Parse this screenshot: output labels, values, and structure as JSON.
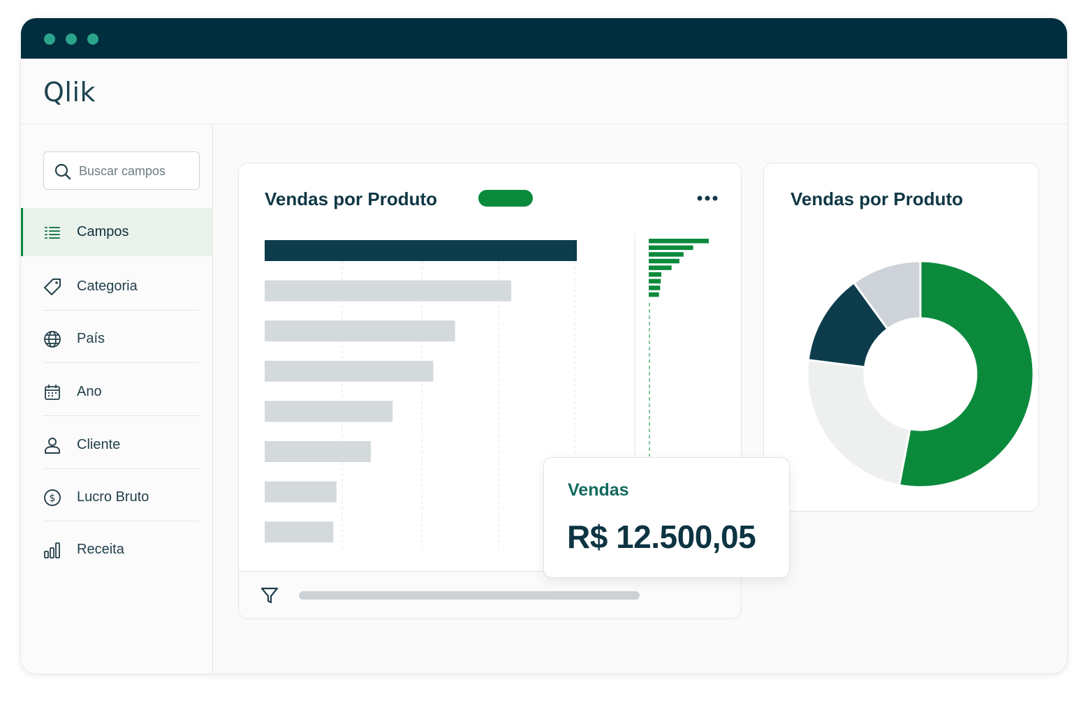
{
  "window": {
    "colors": {
      "titlebar": "#002e3f",
      "accent": "#0b8a3c",
      "dark": "#0d3c4c"
    }
  },
  "header": {
    "logo_text": "Qlik"
  },
  "sidebar": {
    "search": {
      "placeholder": "Buscar campos",
      "icon": "search-icon"
    },
    "items": [
      {
        "label": "Campos",
        "icon": "list-icon",
        "active": true
      },
      {
        "label": "Categoria",
        "icon": "tag-icon"
      },
      {
        "label": "País",
        "icon": "globe-icon"
      },
      {
        "label": "Ano",
        "icon": "calendar-icon"
      },
      {
        "label": "Cliente",
        "icon": "user-icon"
      },
      {
        "label": "Lucro Bruto",
        "icon": "dollar-circle-icon"
      },
      {
        "label": "Receita",
        "icon": "bar-chart-icon"
      }
    ]
  },
  "bar_card": {
    "title": "Vendas por Produto",
    "menu_icon": "more-icon",
    "filter_icon": "filter-icon"
  },
  "donut_card": {
    "title": "Vendas por Produto"
  },
  "kpi": {
    "label": "Vendas",
    "value": "R$ 12.500,05"
  },
  "chart_data": [
    {
      "type": "bar",
      "orientation": "horizontal",
      "values": [
        100,
        79,
        61,
        54,
        41,
        34,
        23,
        22
      ],
      "highlight_index": 0,
      "colors": {
        "highlight": "#0d3c4c",
        "other": "#d4d9dc"
      },
      "grid": true,
      "mini_chart": {
        "type": "bar",
        "orientation": "horizontal",
        "values": [
          100,
          74,
          58,
          51,
          38,
          21,
          20,
          19,
          17
        ],
        "color": "#0b8a3c"
      }
    },
    {
      "type": "pie",
      "donut": true,
      "values": [
        53,
        24,
        13,
        10
      ],
      "colors": [
        "#0b8a3c",
        "#eef0f0",
        "#0d3c4c",
        "#cdd3d8"
      ]
    }
  ]
}
